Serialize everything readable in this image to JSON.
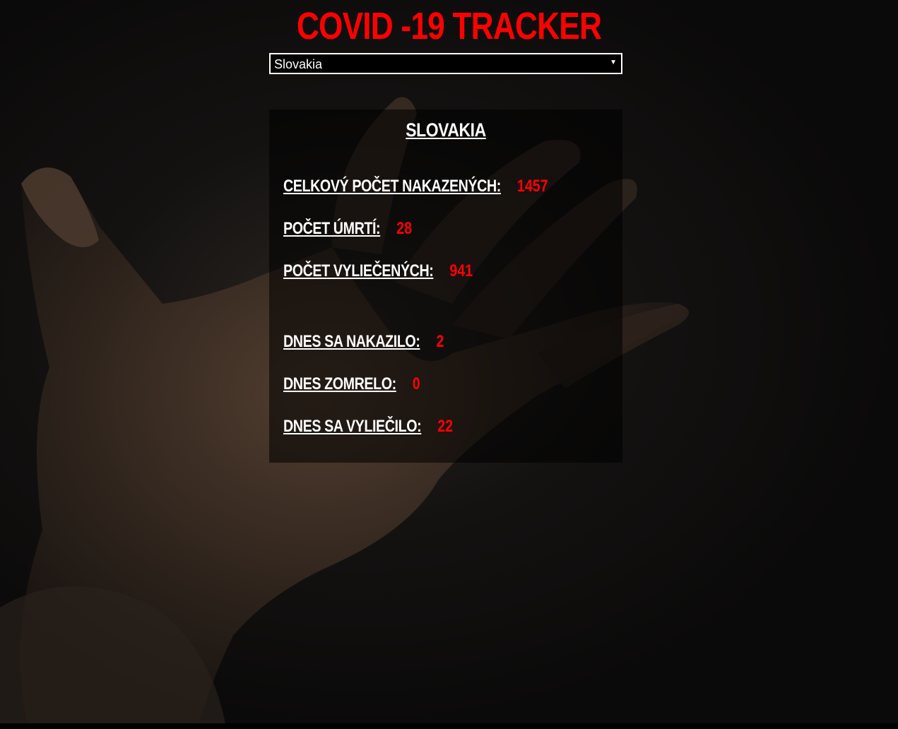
{
  "app": {
    "title": "COVID -19 TRACKER"
  },
  "country_select": {
    "selected": "Slovakia"
  },
  "panel": {
    "country": "SLOVAKIA",
    "stats": [
      {
        "label": "CELKOVÝ POČET NAKAZENÝCH:",
        "value": "1457"
      },
      {
        "label": "POČET ÚMRTÍ:",
        "value": "28"
      },
      {
        "label": "POČET VYLIEČENÝCH:",
        "value": "941"
      },
      {
        "label": "DNES SA NAKAZILO:",
        "value": "2"
      },
      {
        "label": "DNES ZOMRELO:",
        "value": "0"
      },
      {
        "label": "DNES SA VYLIEČILO:",
        "value": "22"
      }
    ]
  },
  "colors": {
    "accent": "#ff0000",
    "text": "#ffffff",
    "background": "#0b0a0a"
  }
}
